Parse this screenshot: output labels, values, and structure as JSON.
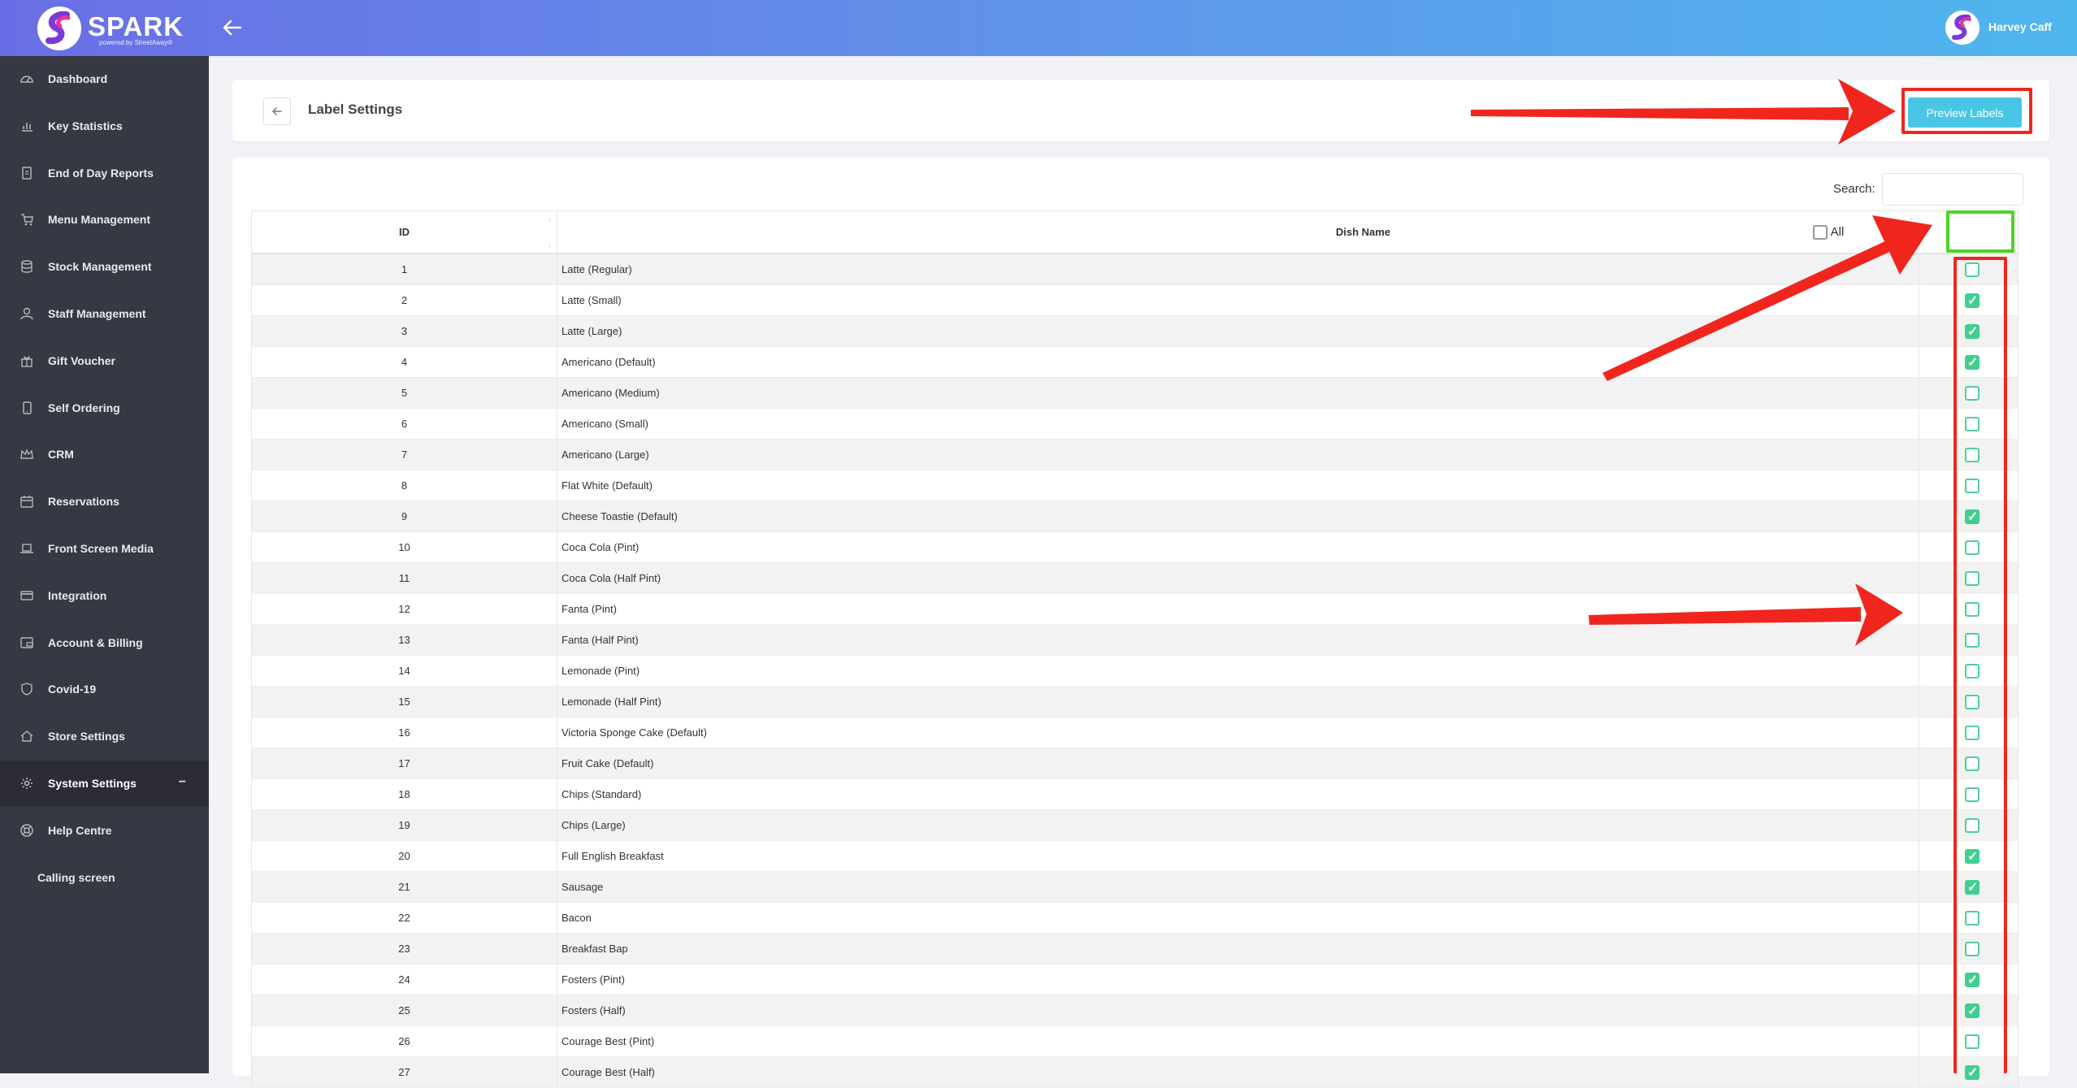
{
  "app": {
    "brand": "SPARK",
    "brand_sub": "powered by StreetAway®",
    "user_name": "Harvey Caff"
  },
  "sidebar": {
    "items": [
      {
        "label": "Dashboard",
        "icon": "dashboard-icon"
      },
      {
        "label": "Key Statistics",
        "icon": "bar-chart-icon"
      },
      {
        "label": "End of Day Reports",
        "icon": "report-icon"
      },
      {
        "label": "Menu Management",
        "icon": "cart-icon"
      },
      {
        "label": "Stock Management",
        "icon": "database-icon"
      },
      {
        "label": "Staff Management",
        "icon": "user-icon"
      },
      {
        "label": "Gift Voucher",
        "icon": "gift-icon"
      },
      {
        "label": "Self Ordering",
        "icon": "tablet-icon"
      },
      {
        "label": "CRM",
        "icon": "crown-icon"
      },
      {
        "label": "Reservations",
        "icon": "calendar-icon"
      },
      {
        "label": "Front Screen Media",
        "icon": "laptop-icon"
      },
      {
        "label": "Integration",
        "icon": "card-icon"
      },
      {
        "label": "Account & Billing",
        "icon": "billing-icon"
      },
      {
        "label": "Covid-19",
        "icon": "shield-icon"
      },
      {
        "label": "Store Settings",
        "icon": "home-icon"
      },
      {
        "label": "System Settings",
        "icon": "gear-icon",
        "active": true,
        "toggle": "−"
      },
      {
        "label": "Help Centre",
        "icon": "lifebuoy-icon"
      },
      {
        "label": "Calling screen",
        "icon": ""
      }
    ]
  },
  "page": {
    "title": "Label Settings",
    "preview_button": "Preview Labels"
  },
  "table": {
    "search_label": "Search:",
    "search_value": "",
    "headers": {
      "id": "ID",
      "name": "Dish Name",
      "all": "All"
    },
    "select_all_checked": false,
    "rows": [
      {
        "id": "1",
        "name": "Latte (Regular)",
        "checked": false
      },
      {
        "id": "2",
        "name": "Latte (Small)",
        "checked": true
      },
      {
        "id": "3",
        "name": "Latte (Large)",
        "checked": true
      },
      {
        "id": "4",
        "name": "Americano (Default)",
        "checked": true
      },
      {
        "id": "5",
        "name": "Americano (Medium)",
        "checked": false
      },
      {
        "id": "6",
        "name": "Americano (Small)",
        "checked": false
      },
      {
        "id": "7",
        "name": "Americano (Large)",
        "checked": false
      },
      {
        "id": "8",
        "name": "Flat White (Default)",
        "checked": false
      },
      {
        "id": "9",
        "name": "Cheese Toastie (Default)",
        "checked": true
      },
      {
        "id": "10",
        "name": "Coca Cola (Pint)",
        "checked": false
      },
      {
        "id": "11",
        "name": "Coca Cola (Half Pint)",
        "checked": false
      },
      {
        "id": "12",
        "name": "Fanta (Pint)",
        "checked": false
      },
      {
        "id": "13",
        "name": "Fanta (Half Pint)",
        "checked": false
      },
      {
        "id": "14",
        "name": "Lemonade (Pint)",
        "checked": false
      },
      {
        "id": "15",
        "name": "Lemonade (Half Pint)",
        "checked": false
      },
      {
        "id": "16",
        "name": "Victoria Sponge Cake (Default)",
        "checked": false
      },
      {
        "id": "17",
        "name": "Fruit Cake (Default)",
        "checked": false
      },
      {
        "id": "18",
        "name": "Chips (Standard)",
        "checked": false
      },
      {
        "id": "19",
        "name": "Chips (Large)",
        "checked": false
      },
      {
        "id": "20",
        "name": "Full English Breakfast",
        "checked": true
      },
      {
        "id": "21",
        "name": "Sausage",
        "checked": true
      },
      {
        "id": "22",
        "name": "Bacon",
        "checked": false
      },
      {
        "id": "23",
        "name": "Breakfast Bap",
        "checked": false
      },
      {
        "id": "24",
        "name": "Fosters (Pint)",
        "checked": true
      },
      {
        "id": "25",
        "name": "Fosters (Half)",
        "checked": true
      },
      {
        "id": "26",
        "name": "Courage Best (Pint)",
        "checked": false
      },
      {
        "id": "27",
        "name": "Courage Best (Half)",
        "checked": true
      }
    ]
  },
  "colors": {
    "accent": "#49c6e5",
    "check": "#3fcf8e",
    "annotation_red": "#f0261e",
    "annotation_green": "#4ed32b",
    "sidebar_bg": "#363843"
  }
}
